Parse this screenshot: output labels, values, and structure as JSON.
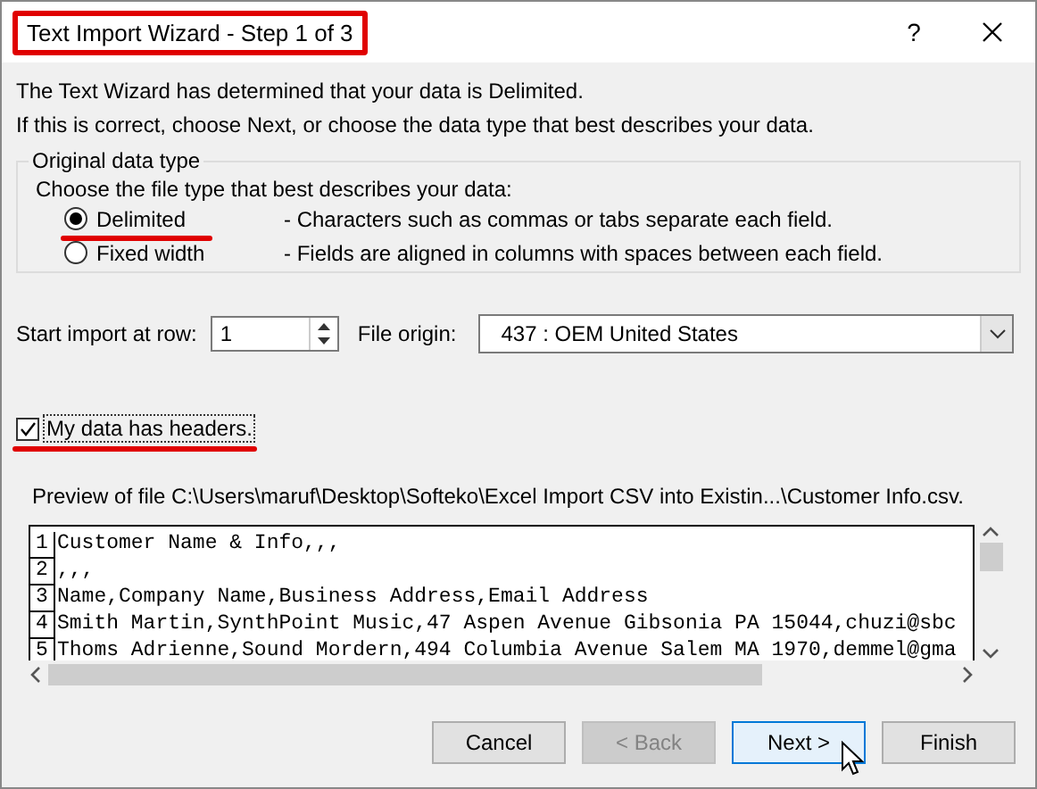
{
  "window": {
    "title": "Text Import Wizard - Step 1 of 3",
    "help": "?"
  },
  "intro": [
    "The Text Wizard has determined that your data is Delimited.",
    "If this is correct, choose Next, or choose the data type that best describes your data."
  ],
  "data_type": {
    "legend": "Original data type",
    "prompt": "Choose the file type that best describes your data:",
    "options": [
      {
        "label": "Delimited",
        "description": "- Characters such as commas or tabs separate each field.",
        "selected": true
      },
      {
        "label": "Fixed width",
        "description": "- Fields are aligned in columns with spaces between each field.",
        "selected": false
      }
    ]
  },
  "start_row": {
    "label": "Start import at row:",
    "value": "1"
  },
  "file_origin": {
    "label": "File origin:",
    "value": "437 : OEM United States"
  },
  "headers": {
    "label": "My data has headers.",
    "checked": true
  },
  "preview": {
    "label": "Preview of file C:\\Users\\maruf\\Desktop\\Softeko\\Excel Import CSV into Existin...\\Customer Info.csv.",
    "lines": [
      {
        "number": "1",
        "text": "Customer Name & Info,,,"
      },
      {
        "number": "2",
        "text": ",,,"
      },
      {
        "number": "3",
        "text": "Name,Company Name,Business Address,Email Address"
      },
      {
        "number": "4",
        "text": "Smith Martin,SynthPoint Music,47 Aspen Avenue Gibsonia PA 15044,chuzi@sbc"
      },
      {
        "number": "5",
        "text": "Thoms Adrienne,Sound Mordern,494 Columbia Avenue Salem MA 1970,demmel@gma"
      }
    ]
  },
  "buttons": [
    {
      "label": "Cancel",
      "disabled": false,
      "default": false
    },
    {
      "label": "< Back",
      "disabled": true,
      "default": false
    },
    {
      "label": "Next >",
      "disabled": false,
      "default": true
    },
    {
      "label": "Finish",
      "disabled": false,
      "default": false
    }
  ]
}
